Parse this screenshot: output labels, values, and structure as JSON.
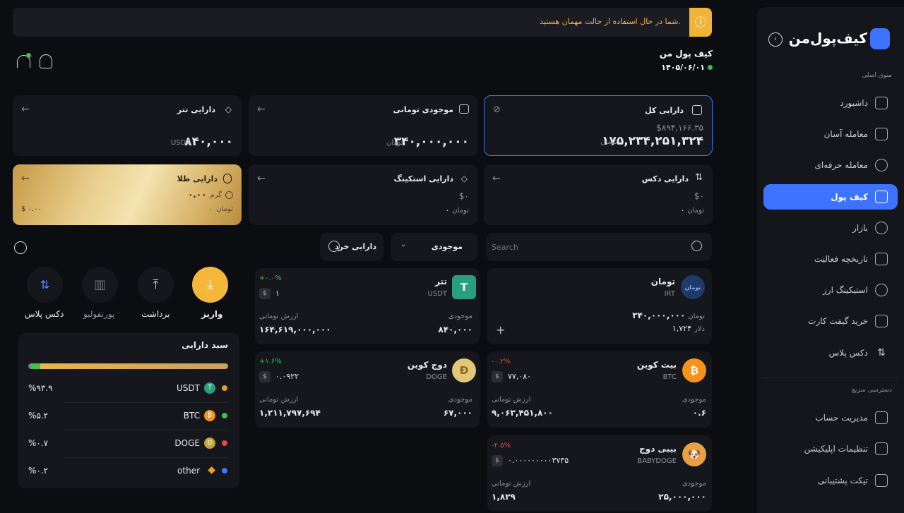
{
  "banner": {
    "text": "شما در حال استفاده از حالت مهمان هستید."
  },
  "brand": {
    "name": "کیف‌پول‌من"
  },
  "sidebar": {
    "main_menu_title": "منوی اصلی",
    "items": [
      {
        "label": "داشبورد"
      },
      {
        "label": "معامله آسان"
      },
      {
        "label": "معامله حرفه‌ای"
      },
      {
        "label": "کیف پول"
      },
      {
        "label": "بازار"
      },
      {
        "label": "تاریخچه فعالیت"
      },
      {
        "label": "استیکینگ ارز"
      },
      {
        "label": "خرید گیفت کارت"
      },
      {
        "label": "دکس پلاس"
      }
    ],
    "quick_title": "دسترسی سریع",
    "quick_items": [
      {
        "label": "مدیریت حساب"
      },
      {
        "label": "تنظیمات اپلیکیشن"
      },
      {
        "label": "تیکت پشتیبانی"
      }
    ],
    "active_color": "#3e73ff"
  },
  "header": {
    "title": "کیف پول من",
    "date": "۱۴۰۵/۰۶/۰۱"
  },
  "assets": {
    "total": {
      "title": "دارایی کل",
      "usd": "$۸۹۴,۱۶۶.۳۵",
      "value": "۱۷۵,۲۳۴,۲۵۱,۳۲۴",
      "unit": "تومان"
    },
    "toman": {
      "title": "موجودی تومانی",
      "value": "۳۴۰,۰۰۰,۰۰۰",
      "unit": "تومان"
    },
    "tether": {
      "title": "دارایی تتر",
      "value": "۸۴۰,۰۰۰",
      "unit": "USDT"
    },
    "dex": {
      "title": "دارایی دکس",
      "usd": "$۰",
      "value": "۰",
      "unit": "تومان"
    },
    "staking": {
      "title": "دارایی استکینگ",
      "usd": "$۰",
      "value": "۰",
      "unit": "تومان"
    },
    "gold": {
      "title": "دارایی طلا",
      "value": "۰.۰۰",
      "gram": "گرم",
      "toman_value": "۰",
      "unit": "تومان",
      "usd": "$ ۰.۰۰"
    }
  },
  "actions": [
    {
      "label": "واریز"
    },
    {
      "label": "برداشت"
    },
    {
      "label": "پورتفولیو"
    },
    {
      "label": "دکس پلاس"
    }
  ],
  "basket": {
    "title": "سبد دارایی",
    "rows": [
      {
        "name": "USDT",
        "percent": "%۹۳.۹",
        "color": "#e0a030"
      },
      {
        "name": "BTC",
        "percent": "%۵.۲",
        "color": "#3fbf4f"
      },
      {
        "name": "DOGE",
        "percent": "%۰.۷",
        "color": "#e24a4a"
      },
      {
        "name": "other",
        "percent": "%۰.۲",
        "color": "#3e73ff"
      }
    ]
  },
  "filters": {
    "search_placeholder": "Search",
    "balance_select": "موجودی",
    "small_assets": "دارایی خرد"
  },
  "coins": {
    "irt": {
      "name": "تومان",
      "symbol": "IRT",
      "balance": "۳۴۰,۰۰۰,۰۰۰",
      "unit": "تومان",
      "usd": "۱,۷۲۴",
      "usd_unit": "دلار",
      "logo_text": "تومان"
    },
    "usdt": {
      "name": "تتر",
      "symbol": "USDT",
      "change": "+۰.۰%",
      "price": "۱",
      "balance_label": "موجودی",
      "balance": "۸۴۰,۰۰۰",
      "value_label": "ارزش تومانی",
      "value": "۱۶۴,۶۱۹,۰۰۰,۰۰۰"
    },
    "btc": {
      "name": "بیت کوین",
      "symbol": "BTC",
      "change": "-۰.۲%",
      "price": "۷۷,۰۸۰",
      "balance_label": "موجودی",
      "balance": "۰.۶",
      "value_label": "ارزش تومانی",
      "value": "۹,۰۶۳,۴۵۱,۸۰۰"
    },
    "doge": {
      "name": "دوج کوین",
      "symbol": "DOGE",
      "change": "+۱.۶%",
      "price": "۰.۰۹۲۲",
      "balance_label": "موجودی",
      "balance": "۶۷,۰۰۰",
      "value_label": "ارزش تومانی",
      "value": "۱,۲۱۱,۷۹۷,۶۹۴"
    },
    "babydoge": {
      "name": "بیبی دوج",
      "symbol": "BABYDOGE",
      "change": "-۲.۵%",
      "price": "۰.۰۰۰۰۰۰۰۰۰۳۷۳۵",
      "balance_label": "موجودی",
      "balance": "۲۵,۰۰۰,۰۰۰",
      "value_label": "ارزش تومانی",
      "value": "۱,۸۲۹"
    }
  }
}
